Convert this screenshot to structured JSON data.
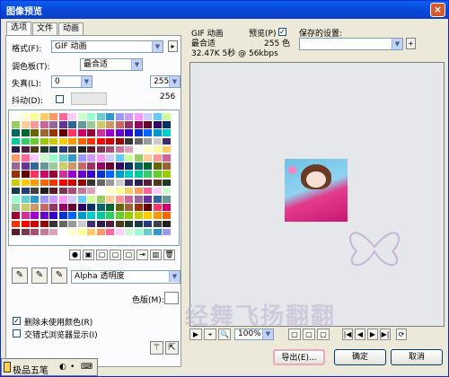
{
  "window": {
    "title": "图像预览",
    "close_glyph": "×"
  },
  "tabs": [
    {
      "label": "选项"
    },
    {
      "label": "文件"
    },
    {
      "label": "动画"
    }
  ],
  "options": {
    "format_label": "格式(F):",
    "format_value": "GIF 动画",
    "format_more": "▸",
    "palette_label": "调色板(T):",
    "palette_value": "最合适",
    "loss_label": "失真(L):",
    "loss_value": "0",
    "colors_value": "255",
    "dither_label": "抖动(D):",
    "dither_count": "256",
    "transparency_value": "Alpha 透明度",
    "matte_label": "色版(M):",
    "remove_unused_label": "删除未使用颜色(R)",
    "remove_unused_checked": true,
    "interlace_label": "交错式浏览器显示(I)",
    "interlace_checked": false
  },
  "palette_swatch_colors": [
    "#ffffff",
    "#ffffcc",
    "#ffff99",
    "#ffcc66",
    "#ff9966",
    "#ff6699",
    "#ffccff",
    "#ccffcc",
    "#99ffcc",
    "#66cccc",
    "#3399cc",
    "#9999ff",
    "#cc99ff",
    "#ff99ff",
    "#ccccff",
    "#66ccff",
    "#ccff99",
    "#99cc66",
    "#ffcc99",
    "#ff9999",
    "#cc6699",
    "#996699",
    "#663399",
    "#336699",
    "#669999",
    "#99cc99",
    "#cccc66",
    "#cc9966",
    "#cc6666",
    "#993366",
    "#990066",
    "#660033",
    "#330066",
    "#003366",
    "#006666",
    "#006633",
    "#666600",
    "#996633",
    "#993300",
    "#660000",
    "#ff3366",
    "#cc0066",
    "#990033",
    "#cc3399",
    "#9900cc",
    "#6600cc",
    "#3300cc",
    "#0033cc",
    "#0066ff",
    "#0099cc",
    "#00cccc",
    "#00cc99",
    "#33cc66",
    "#66cc33",
    "#99cc00",
    "#cccc00",
    "#ffcc00",
    "#ff9900",
    "#ff6600",
    "#ff3300",
    "#ff0000",
    "#cc0000",
    "#990000",
    "#333333",
    "#666666",
    "#999999",
    "#cccccc",
    "#3d2b6b",
    "#2a1e4e",
    "#511e3b",
    "#4b3b19",
    "#1c3d2c",
    "#183c4f",
    "#263b7a",
    "#404040",
    "#202020",
    "#5e1a24",
    "#7a3850",
    "#a64f73",
    "#c47a96",
    "#e0a0bd"
  ],
  "palette_toolbar": [
    "●",
    "▣",
    "▢",
    "▢",
    "▢",
    "⇥",
    "▥",
    "🗑"
  ],
  "preview": {
    "format_text": "GIF 动画",
    "palette_text": "最合适",
    "size_text": "32.47K 5秒 @ 56kbps",
    "preview_label": "预览(P)",
    "preview_checked": true,
    "color_count": "255 色",
    "saved_settings_label": "保存的设置:",
    "saved_settings_value": "",
    "add_glyph": "+",
    "zoom_value": "100%"
  },
  "preview_tools": [
    "▶",
    "⌖",
    "🔍",
    "▢",
    "▢",
    "▢",
    "|◀",
    "◀",
    "▶",
    "▶|",
    "⟳"
  ],
  "buttons": {
    "export": "导出(E)...",
    "ok": "确定",
    "cancel": "取消"
  },
  "taskbar": {
    "label": "极品五笔"
  },
  "watermark": "经舞飞扬翻翻"
}
